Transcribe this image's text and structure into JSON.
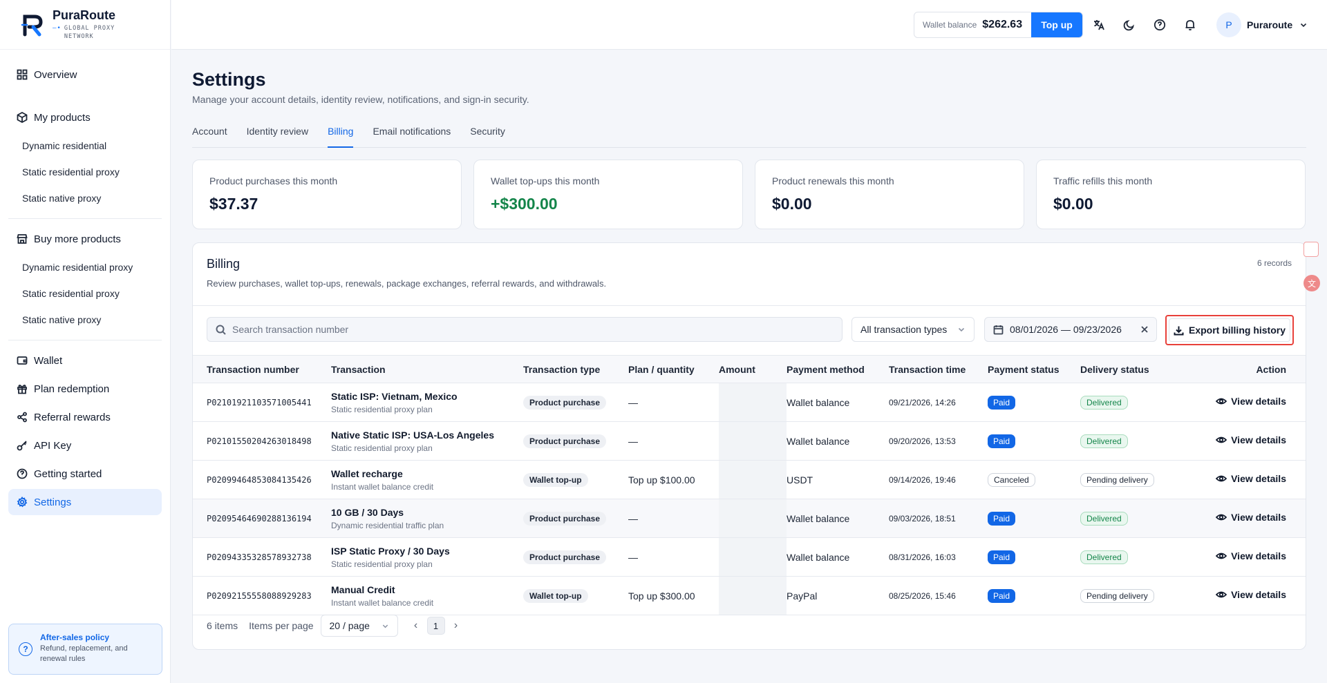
{
  "brand": {
    "name": "PuraRoute",
    "tagline": "GLOBAL PROXY NETWORK"
  },
  "sidebar": {
    "overview": "Overview",
    "my_products": "My products",
    "my_products_items": [
      "Dynamic residential",
      "Static residential proxy",
      "Static native proxy"
    ],
    "buy_more": "Buy more products",
    "buy_more_items": [
      "Dynamic residential proxy",
      "Static residential proxy",
      "Static native proxy"
    ],
    "wallet": "Wallet",
    "plan_redemption": "Plan redemption",
    "referral_rewards": "Referral rewards",
    "api_key": "API Key",
    "getting_started": "Getting started",
    "settings": "Settings",
    "policy": {
      "title": "After-sales policy",
      "text": "Refund, replacement, and renewal rules"
    }
  },
  "header": {
    "wallet_label": "Wallet balance",
    "wallet_value": "$262.63",
    "topup_label": "Top up",
    "user_initial": "P",
    "user_name": "Puraroute",
    "icons": [
      "translate-icon",
      "moon-icon",
      "help-icon",
      "bell-icon"
    ]
  },
  "page": {
    "title": "Settings",
    "description": "Manage your account details, identity review, notifications, and sign-in security.",
    "tabs": [
      {
        "label": "Account",
        "active": false
      },
      {
        "label": "Identity review",
        "active": false
      },
      {
        "label": "Billing",
        "active": true
      },
      {
        "label": "Email notifications",
        "active": false
      },
      {
        "label": "Security",
        "active": false
      }
    ]
  },
  "stats": [
    {
      "label": "Product purchases this month",
      "value": "$37.37",
      "color": "#0f1a33"
    },
    {
      "label": "Wallet top-ups this month",
      "value": "+$300.00",
      "color": "#14854a"
    },
    {
      "label": "Product renewals this month",
      "value": "$0.00",
      "color": "#0f1a33"
    },
    {
      "label": "Traffic refills this month",
      "value": "$0.00",
      "color": "#0f1a33"
    }
  ],
  "billing": {
    "title": "Billing",
    "description": "Review purchases, wallet top-ups, renewals, package exchanges, referral rewards, and withdrawals.",
    "records": "6 records",
    "search_placeholder": "Search transaction number",
    "type_filter": "All transaction types",
    "date_range": "08/01/2026 — 09/23/2026",
    "export_label": "Export billing history",
    "columns": [
      "Transaction number",
      "Transaction",
      "Transaction type",
      "Plan / quantity",
      "Amount",
      "Payment method",
      "Transaction time",
      "Payment status",
      "Delivery status",
      "Action"
    ],
    "rows": [
      {
        "number": "P02101921103571005441",
        "title": "Static ISP: Vietnam, Mexico",
        "subtitle": "Static residential proxy plan",
        "type": "Product purchase",
        "plan": "—",
        "method": "Wallet balance",
        "time": "09/21/2026, 14:26",
        "payment": "Paid",
        "delivery": "Delivered",
        "action": "View details"
      },
      {
        "number": "P02101550204263018498",
        "title": "Native Static ISP: USA-Los Angeles",
        "subtitle": "Static residential proxy plan",
        "type": "Product purchase",
        "plan": "—",
        "method": "Wallet balance",
        "time": "09/20/2026, 13:53",
        "payment": "Paid",
        "delivery": "Delivered",
        "action": "View details"
      },
      {
        "number": "P02099464853084135426",
        "title": "Wallet recharge",
        "subtitle": "Instant wallet balance credit",
        "type": "Wallet top-up",
        "plan": "Top up $100.00",
        "method": "USDT",
        "time": "09/14/2026, 19:46",
        "payment": "Canceled",
        "delivery": "Pending delivery",
        "action": "View details"
      },
      {
        "number": "P02095464690288136194",
        "title": "10 GB / 30 Days",
        "subtitle": "Dynamic residential traffic plan",
        "type": "Product purchase",
        "plan": "—",
        "method": "Wallet balance",
        "time": "09/03/2026, 18:51",
        "payment": "Paid",
        "delivery": "Delivered",
        "action": "View details"
      },
      {
        "number": "P02094335328578932738",
        "title": "ISP Static Proxy / 30 Days",
        "subtitle": "Static residential proxy plan",
        "type": "Product purchase",
        "plan": "—",
        "method": "Wallet balance",
        "time": "08/31/2026, 16:03",
        "payment": "Paid",
        "delivery": "Delivered",
        "action": "View details"
      },
      {
        "number": "P02092155558088929283",
        "title": "Manual Credit",
        "subtitle": "Instant wallet balance credit",
        "type": "Wallet top-up",
        "plan": "Top up $300.00",
        "method": "PayPal",
        "time": "08/25/2026, 15:46",
        "payment": "Paid",
        "delivery": "Pending delivery",
        "action": "View details"
      }
    ],
    "pager": {
      "total": "6 items",
      "per_page_label": "Items per page",
      "per_page_value": "20 / page",
      "current_page": "1"
    }
  }
}
